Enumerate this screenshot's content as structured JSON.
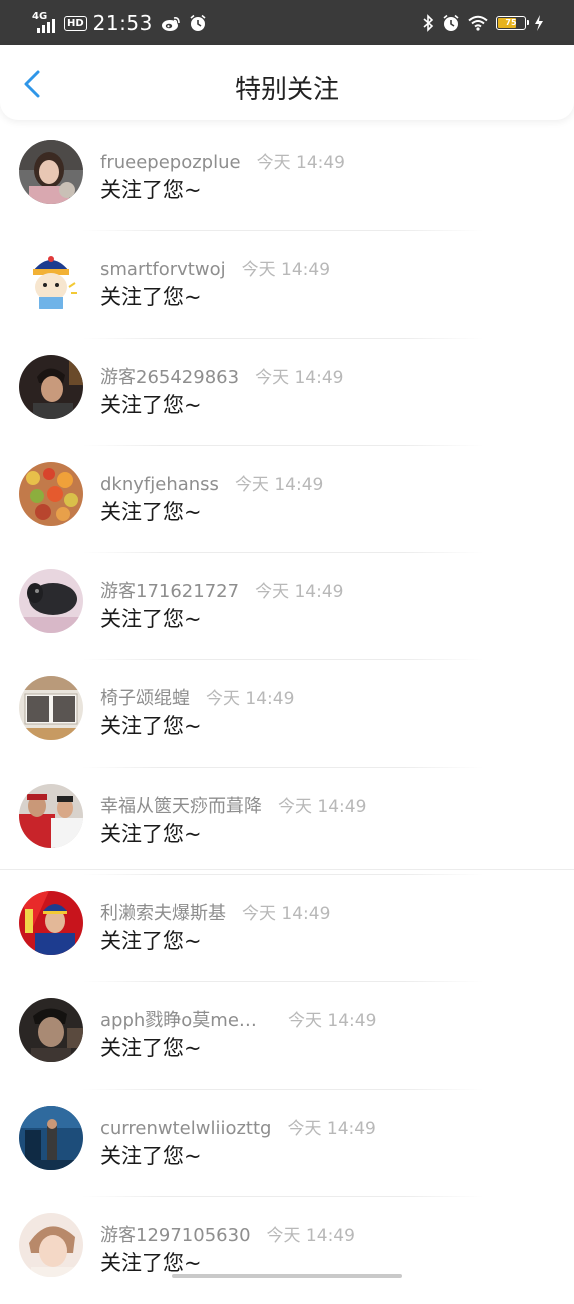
{
  "status_bar": {
    "network": "4G",
    "hd": "HD",
    "time": "21:53",
    "battery": "75",
    "battery_level": 0.75,
    "icons": [
      "signal-icon",
      "weibo-icon",
      "alarm-icon",
      "bluetooth-icon",
      "alarm-icon",
      "wifi-icon",
      "battery-icon",
      "charging-icon"
    ]
  },
  "header": {
    "title": "特别关注",
    "back_icon": "chevron-left-icon",
    "accent_color": "#2f96e8"
  },
  "items": [
    {
      "name": "frueepepozplue",
      "time": "今天 14:49",
      "message": "关注了您~"
    },
    {
      "name": "smartforvtwoj",
      "time": "今天 14:49",
      "message": "关注了您~"
    },
    {
      "name": "游客265429863",
      "time": "今天 14:49",
      "message": "关注了您~"
    },
    {
      "name": "dknyfjehanss",
      "time": "今天 14:49",
      "message": "关注了您~"
    },
    {
      "name": "游客171621727",
      "time": "今天 14:49",
      "message": "关注了您~"
    },
    {
      "name": "椅子颂绲蝗",
      "time": "今天 14:49",
      "message": "关注了您~"
    },
    {
      "name": "幸福从篋天痧而葺降",
      "time": "今天 14:49",
      "message": "关注了您~"
    },
    {
      "name": "利濑索夫爆斯基",
      "time": "今天 14:49",
      "message": "关注了您~"
    },
    {
      "name": "apph戮睁o莫me…",
      "time": "今天 14:49",
      "message": "关注了您~"
    },
    {
      "name": "currenwtelwliiozttg",
      "time": "今天 14:49",
      "message": "关注了您~"
    },
    {
      "name": "游客1297105630",
      "time": "今天 14:49",
      "message": "关注了您~"
    }
  ]
}
